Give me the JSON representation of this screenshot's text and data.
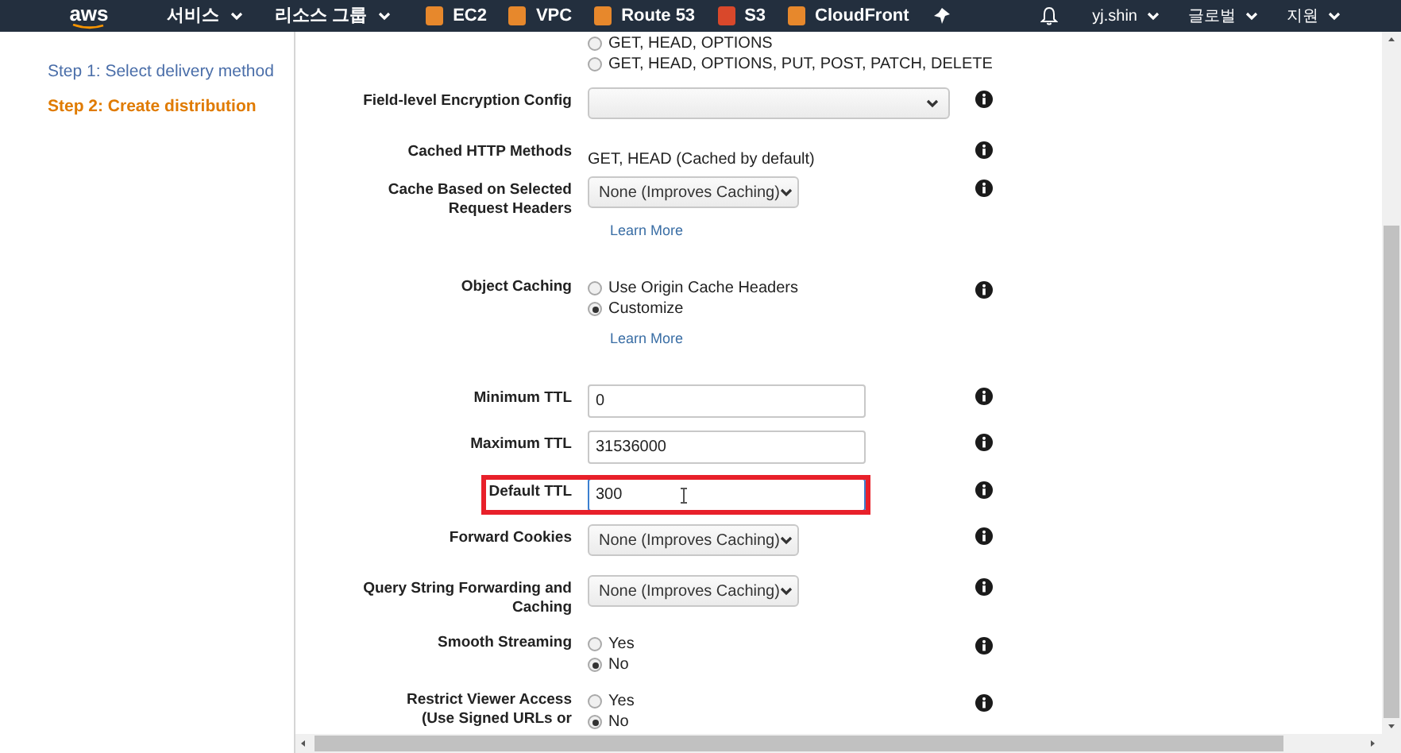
{
  "nav": {
    "logo": "aws",
    "menus": [
      {
        "label": "서비스"
      },
      {
        "label": "리소스 그룹"
      }
    ],
    "shortcuts": [
      {
        "label": "EC2",
        "color": "#e7882c"
      },
      {
        "label": "VPC",
        "color": "#e7882c"
      },
      {
        "label": "Route 53",
        "color": "#e7882c"
      },
      {
        "label": "S3",
        "color": "#d9482b"
      },
      {
        "label": "CloudFront",
        "color": "#e7882c"
      }
    ],
    "right_menus": [
      {
        "label": "yj.shin"
      },
      {
        "label": "글로벌"
      },
      {
        "label": "지원"
      }
    ]
  },
  "sidebar": {
    "steps": [
      {
        "label": "Step 1: Select delivery method",
        "selected": false
      },
      {
        "label": "Step 2: Create distribution",
        "selected": true
      }
    ]
  },
  "form": {
    "rows": [
      {
        "kind": "radios",
        "label": "",
        "info": false,
        "options": [
          {
            "label": "GET, HEAD, OPTIONS",
            "selected": false
          },
          {
            "label": "GET, HEAD, OPTIONS, PUT, POST, PATCH, DELETE",
            "selected": false
          }
        ]
      },
      {
        "kind": "select",
        "label": "Field-level Encryption Config",
        "value": "",
        "wide": true,
        "info": true
      },
      {
        "kind": "text",
        "label": "Cached HTTP Methods",
        "value": "GET, HEAD (Cached by default)",
        "info": true
      },
      {
        "kind": "select",
        "label": "Cache Based on Selected\nRequest Headers",
        "value": "None (Improves Caching)",
        "wide": false,
        "link": "Learn More",
        "info": true
      },
      {
        "kind": "radios",
        "label": "Object Caching",
        "info": true,
        "link": "Learn More",
        "options": [
          {
            "label": "Use Origin Cache Headers",
            "selected": false
          },
          {
            "label": "Customize",
            "selected": true
          }
        ]
      },
      {
        "kind": "input",
        "label": "Minimum TTL",
        "value": "0",
        "info": true
      },
      {
        "kind": "input",
        "label": "Maximum TTL",
        "value": "31536000",
        "info": true
      },
      {
        "kind": "input",
        "label": "Default TTL",
        "value": "300",
        "highlighted": true,
        "info": true
      },
      {
        "kind": "select",
        "label": "Forward Cookies",
        "value": "None (Improves Caching)",
        "wide": false,
        "info": true
      },
      {
        "kind": "select",
        "label": "Query String Forwarding and\nCaching",
        "value": "None (Improves Caching)",
        "wide": false,
        "info": true
      },
      {
        "kind": "radios",
        "label": "Smooth Streaming",
        "info": true,
        "options": [
          {
            "label": "Yes",
            "selected": false
          },
          {
            "label": "No",
            "selected": true
          }
        ]
      },
      {
        "kind": "radios",
        "label": "Restrict Viewer Access\n(Use Signed URLs or",
        "info": true,
        "options": [
          {
            "label": "Yes",
            "selected": false
          },
          {
            "label": "No",
            "selected": true
          }
        ]
      }
    ]
  }
}
